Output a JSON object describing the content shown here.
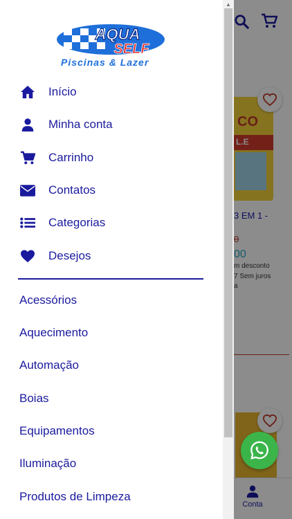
{
  "brand": {
    "logo_top": "AQUA",
    "logo_bottom": "SELF",
    "tagline": "Piscinas & Lazer"
  },
  "menu": {
    "items": [
      {
        "label": "Início",
        "icon": "home-icon"
      },
      {
        "label": "Minha conta",
        "icon": "user-icon"
      },
      {
        "label": "Carrinho",
        "icon": "cart-icon"
      },
      {
        "label": "Contatos",
        "icon": "envelope-icon"
      },
      {
        "label": "Categorias",
        "icon": "list-icon"
      },
      {
        "label": "Desejos",
        "icon": "heart-icon"
      }
    ]
  },
  "categories": {
    "items": [
      "Acessórios",
      "Aquecimento",
      "Automação",
      "Boias",
      "Equipamentos",
      "Iluminação",
      "Produtos de Limpeza"
    ]
  },
  "background": {
    "product_title_partial": "3 EM 1 -",
    "old_price_partial": "0",
    "price_partial": "00",
    "discount_text_partial": "m desconto",
    "installments_partial": "7 Sem juros",
    "installments_suffix_partial": "a",
    "bucket_label_partial": "CO",
    "bucket_band_partial": "L.E",
    "bottom_nav_label": "Conta"
  },
  "colors": {
    "primary": "#1a1a9e",
    "whatsapp": "#3bb54a",
    "logo_blue": "#1e6fd9"
  }
}
